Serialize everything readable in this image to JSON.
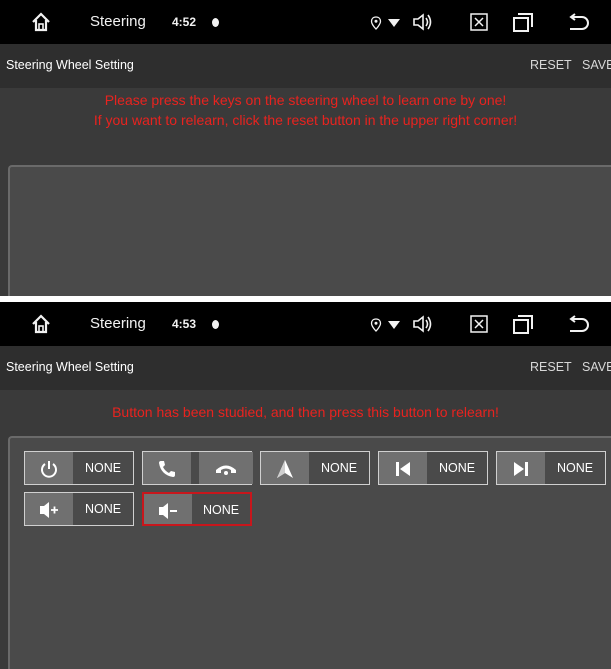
{
  "screens": [
    {
      "status_bar": {
        "app_name": "Steering",
        "time": "4:52"
      },
      "title_bar": {
        "title": "Steering Wheel Setting",
        "reset_label": "RESET",
        "save_label": "SAVE"
      },
      "message": {
        "line1": "Please press the keys on the steering wheel to learn one by one!",
        "line2": "If you want to relearn, click the reset button in the upper right corner!"
      }
    },
    {
      "status_bar": {
        "app_name": "Steering",
        "time": "4:53"
      },
      "title_bar": {
        "title": "Steering Wheel Setting",
        "reset_label": "RESET",
        "save_label": "SAVE"
      },
      "message": {
        "line1": "Button has been studied, and then press this button to relearn!"
      },
      "keys": [
        {
          "icon": "power-icon",
          "label": "NONE"
        },
        {
          "icon": "phone-answer-icon",
          "icon2": "phone-hangup-icon"
        },
        {
          "icon": "navigation-icon",
          "label": "NONE"
        },
        {
          "icon": "previous-track-icon",
          "label": "NONE"
        },
        {
          "icon": "next-track-icon",
          "label": "NONE"
        },
        {
          "icon": "volume-up-icon",
          "label": "NONE"
        },
        {
          "icon": "volume-down-icon",
          "label": "NONE",
          "selected": true
        }
      ]
    }
  ],
  "colors": {
    "message_red": "#e8231f",
    "selected_border": "#c8161c",
    "background": "#3a3a3a",
    "status_bar": "#000000"
  }
}
